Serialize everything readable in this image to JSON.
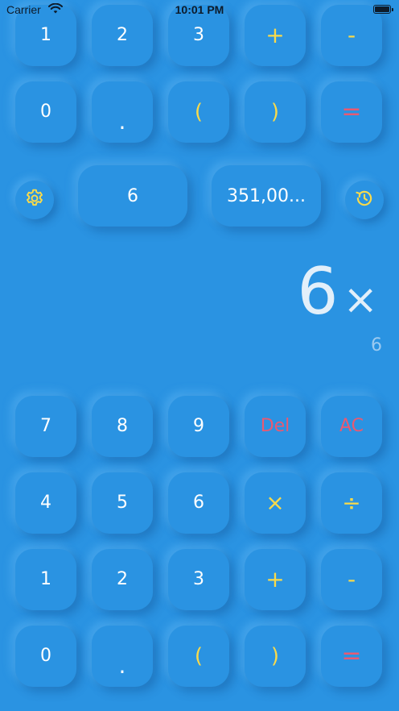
{
  "status_bar": {
    "carrier": "Carrier",
    "time": "10:01 PM"
  },
  "keypad_top": [
    {
      "label": "1",
      "kind": "num"
    },
    {
      "label": "2",
      "kind": "num"
    },
    {
      "label": "3",
      "kind": "num"
    },
    {
      "label": "+",
      "kind": "op"
    },
    {
      "label": "-",
      "kind": "op"
    },
    {
      "label": "0",
      "kind": "num"
    },
    {
      "label": ".",
      "kind": "dot"
    },
    {
      "label": "(",
      "kind": "paren"
    },
    {
      "label": ")",
      "kind": "paren"
    },
    {
      "label": "=",
      "kind": "eq"
    }
  ],
  "memory": {
    "left_value": "6",
    "right_value": "351,00..."
  },
  "display": {
    "expression_number": "6",
    "expression_operator": "×",
    "result": "6"
  },
  "keypad_bottom": [
    {
      "label": "7",
      "kind": "num"
    },
    {
      "label": "8",
      "kind": "num"
    },
    {
      "label": "9",
      "kind": "num"
    },
    {
      "label": "Del",
      "kind": "red"
    },
    {
      "label": "AC",
      "kind": "red"
    },
    {
      "label": "4",
      "kind": "num"
    },
    {
      "label": "5",
      "kind": "num"
    },
    {
      "label": "6",
      "kind": "num"
    },
    {
      "label": "×",
      "kind": "op"
    },
    {
      "label": "÷",
      "kind": "op"
    },
    {
      "label": "1",
      "kind": "num"
    },
    {
      "label": "2",
      "kind": "num"
    },
    {
      "label": "3",
      "kind": "num"
    },
    {
      "label": "+",
      "kind": "op"
    },
    {
      "label": "-",
      "kind": "op"
    },
    {
      "label": "0",
      "kind": "num"
    },
    {
      "label": ".",
      "kind": "dot"
    },
    {
      "label": "(",
      "kind": "paren"
    },
    {
      "label": ")",
      "kind": "paren"
    },
    {
      "label": "=",
      "kind": "eq"
    }
  ],
  "icons": {
    "settings": "gear-icon",
    "history": "history-icon"
  },
  "colors": {
    "background": "#2a93e2",
    "text": "#ffffff",
    "operator": "#f8da4b",
    "danger": "#e85a72",
    "result": "#9ccaf0"
  }
}
